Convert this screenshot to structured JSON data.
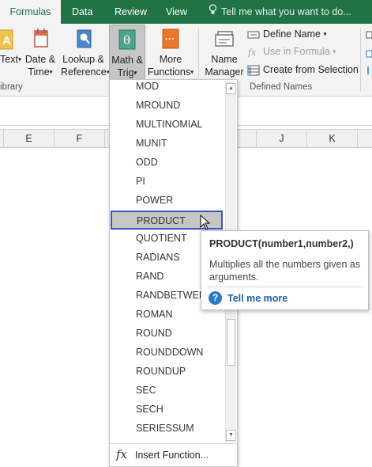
{
  "tabs": [
    {
      "label": "Formulas",
      "active": true
    },
    {
      "label": "Data",
      "active": false
    },
    {
      "label": "Review",
      "active": false
    },
    {
      "label": "View",
      "active": false
    }
  ],
  "tell_me": {
    "placeholder": "Tell me what you want to do...",
    "icon": "lightbulb-icon"
  },
  "ribbon": {
    "text_button": {
      "label": "Text",
      "icon": "text-icon"
    },
    "date_time_button": {
      "line1": "Date &",
      "line2": "Time",
      "icon": "calendar-icon"
    },
    "lookup_button": {
      "line1": "Lookup &",
      "line2": "Reference",
      "icon": "lookup-book-icon"
    },
    "math_trig_button": {
      "line1": "Math &",
      "line2": "Trig",
      "icon": "theta-icon"
    },
    "more_functions_button": {
      "line1": "More",
      "line2": "Functions",
      "icon": "more-functions-icon"
    },
    "library_group_label": "ibrary",
    "name_manager_button": {
      "line1": "Name",
      "line2": "Manager",
      "icon": "name-manager-icon"
    },
    "define_name": "Define Name",
    "use_in_formula": "Use in Formula",
    "create_from_selection": "Create from Selection",
    "defined_names_group_label": "Defined Names"
  },
  "columns": [
    "E",
    "F",
    "J",
    "K"
  ],
  "math_menu": {
    "items": [
      "MOD",
      "MROUND",
      "MULTINOMIAL",
      "MUNIT",
      "ODD",
      "PI",
      "POWER",
      "PRODUCT",
      "QUOTIENT",
      "RADIANS",
      "RAND",
      "RANDBETWEEN",
      "ROMAN",
      "ROUND",
      "ROUNDDOWN",
      "ROUNDUP",
      "SEC",
      "SECH",
      "SERIESSUM"
    ],
    "highlighted": "PRODUCT",
    "insert_function": "Insert Function..."
  },
  "tooltip": {
    "title": "PRODUCT(number1,number2,)",
    "description": "Multiplies all the numbers given as arguments.",
    "link": "Tell me more"
  },
  "colors": {
    "excel_green": "#217346",
    "selection_border": "#3b51c8",
    "link_blue": "#1e5fa8"
  }
}
